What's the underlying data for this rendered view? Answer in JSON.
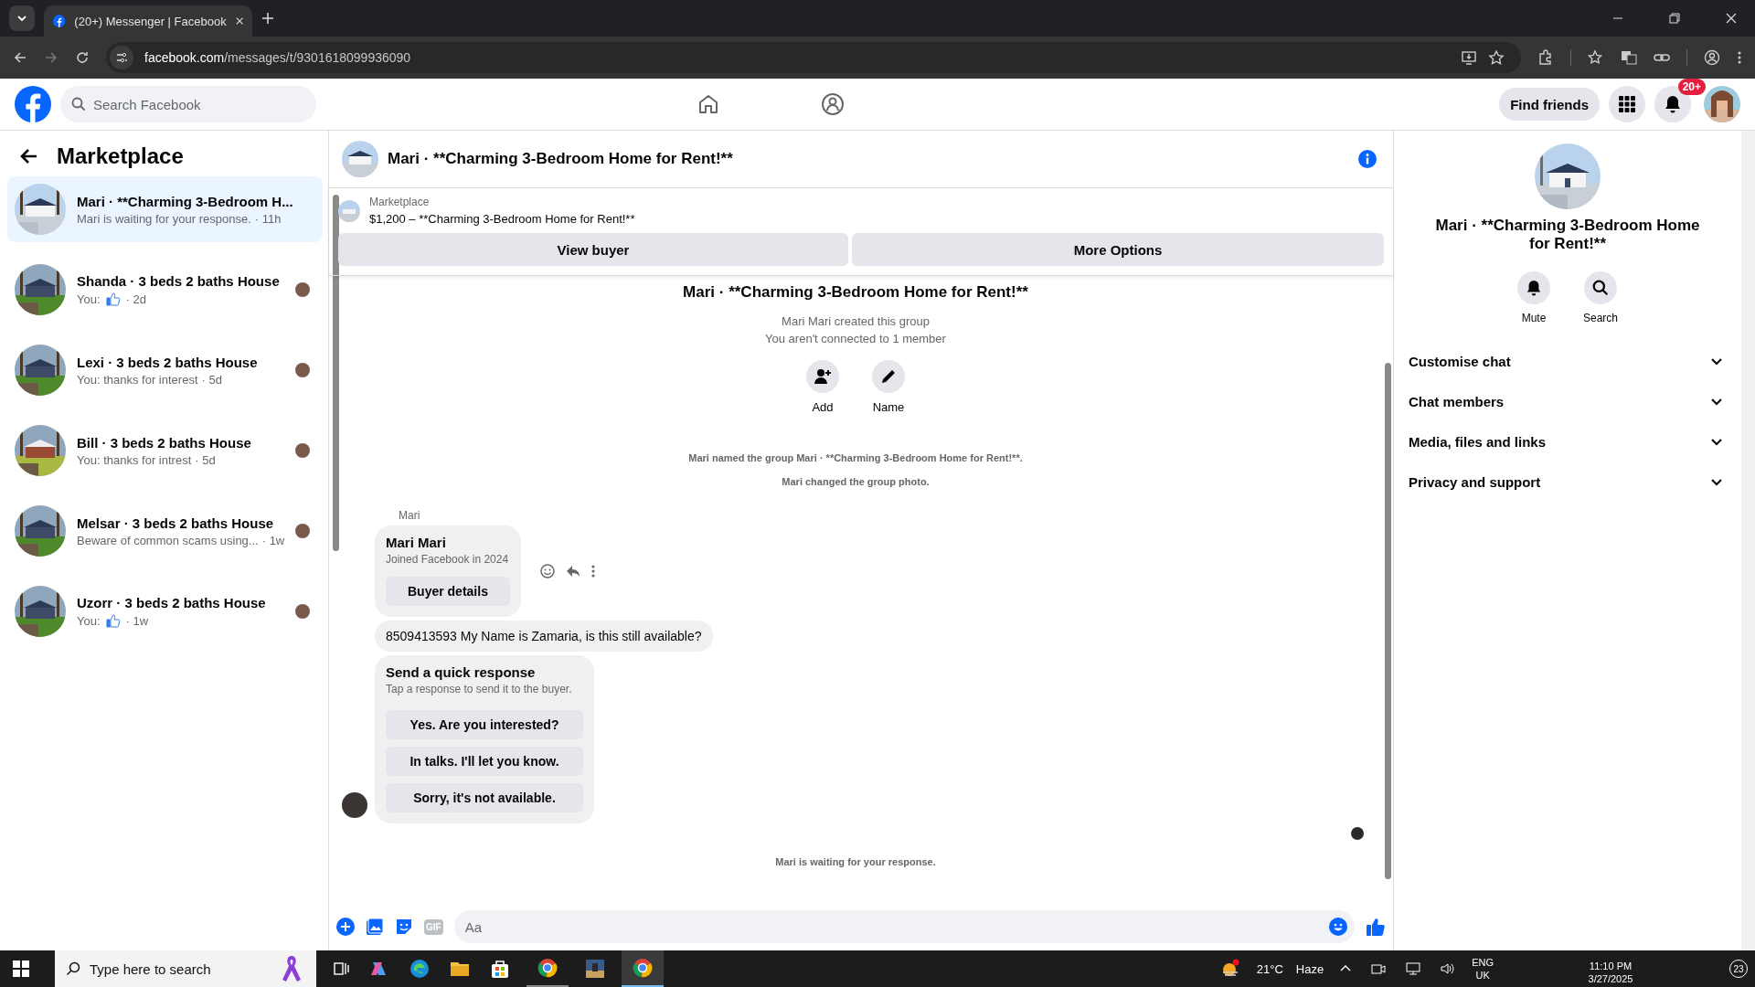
{
  "browser": {
    "tab_title": "(20+) Messenger | Facebook",
    "url_host": "facebook.com",
    "url_path": "/messages/t/9301618099936090"
  },
  "header": {
    "search_placeholder": "Search Facebook",
    "find_friends": "Find friends",
    "notification_badge": "20+"
  },
  "sidebar": {
    "title": "Marketplace",
    "conversations": [
      {
        "name": "Mari · **Charming 3-Bedroom H...",
        "preview": "Mari is waiting for your response.",
        "time": "· 11h",
        "like": false,
        "selected": true
      },
      {
        "name": "Shanda · 3 beds 2 baths House",
        "preview": "You:",
        "time": "· 2d",
        "like": true,
        "selected": false
      },
      {
        "name": "Lexi · 3 beds 2 baths House",
        "preview": "You: thanks for interest",
        "time": "· 5d",
        "like": false,
        "selected": false
      },
      {
        "name": "Bill · 3 beds 2 baths House",
        "preview": "You: thanks for intrest",
        "time": "· 5d",
        "like": false,
        "selected": false
      },
      {
        "name": "Melsar · 3 beds 2 baths House",
        "preview": "Beware of common scams using...",
        "time": "· 1w",
        "like": false,
        "selected": false
      },
      {
        "name": "Uzorr · 3 beds 2 baths House",
        "preview": "You:",
        "time": "· 1w",
        "like": true,
        "selected": false
      }
    ]
  },
  "chat": {
    "title": "Mari · **Charming 3-Bedroom Home for Rent!**",
    "listing": {
      "label": "Marketplace",
      "detail": "$1,200 – **Charming 3-Bedroom Home for Rent!**"
    },
    "buttons": [
      "View buyer",
      "More Options"
    ],
    "intro": {
      "title": "Mari · **Charming 3-Bedroom Home for Rent!**",
      "lines": [
        "Mari Mari created this group",
        "You aren't connected to 1 member"
      ],
      "actions": [
        "Add",
        "Name"
      ]
    },
    "events": [
      "Mari named the group Mari · **Charming 3-Bedroom Home for Rent!**.",
      "Mari changed the group photo."
    ],
    "sender": "Mari",
    "card": {
      "name": "Mari Mari",
      "subtitle": "Joined Facebook in 2024",
      "button": "Buyer details"
    },
    "message": "8509413593 My Name is Zamaria, is this still available?",
    "quick": {
      "title": "Send a quick response",
      "subtitle": "Tap a response to send it to the buyer.",
      "options": [
        "Yes. Are you interested?",
        "In talks. I'll let you know.",
        "Sorry, it's not available."
      ]
    },
    "status": "Mari is waiting for your response.",
    "composer": {
      "placeholder": "Aa",
      "gif": "GIF"
    }
  },
  "details": {
    "title": "Mari · **Charming 3-Bedroom Home for Rent!**",
    "actions": [
      "Mute",
      "Search"
    ],
    "sections": [
      "Customise chat",
      "Chat members",
      "Media, files and links",
      "Privacy and support"
    ]
  },
  "taskbar": {
    "search_placeholder": "Type here to search",
    "temperature": "21°C",
    "weather": "Haze",
    "lang": [
      "ENG",
      "UK"
    ],
    "time": "11:10 PM",
    "date": "3/27/2025",
    "notifications": "23"
  }
}
